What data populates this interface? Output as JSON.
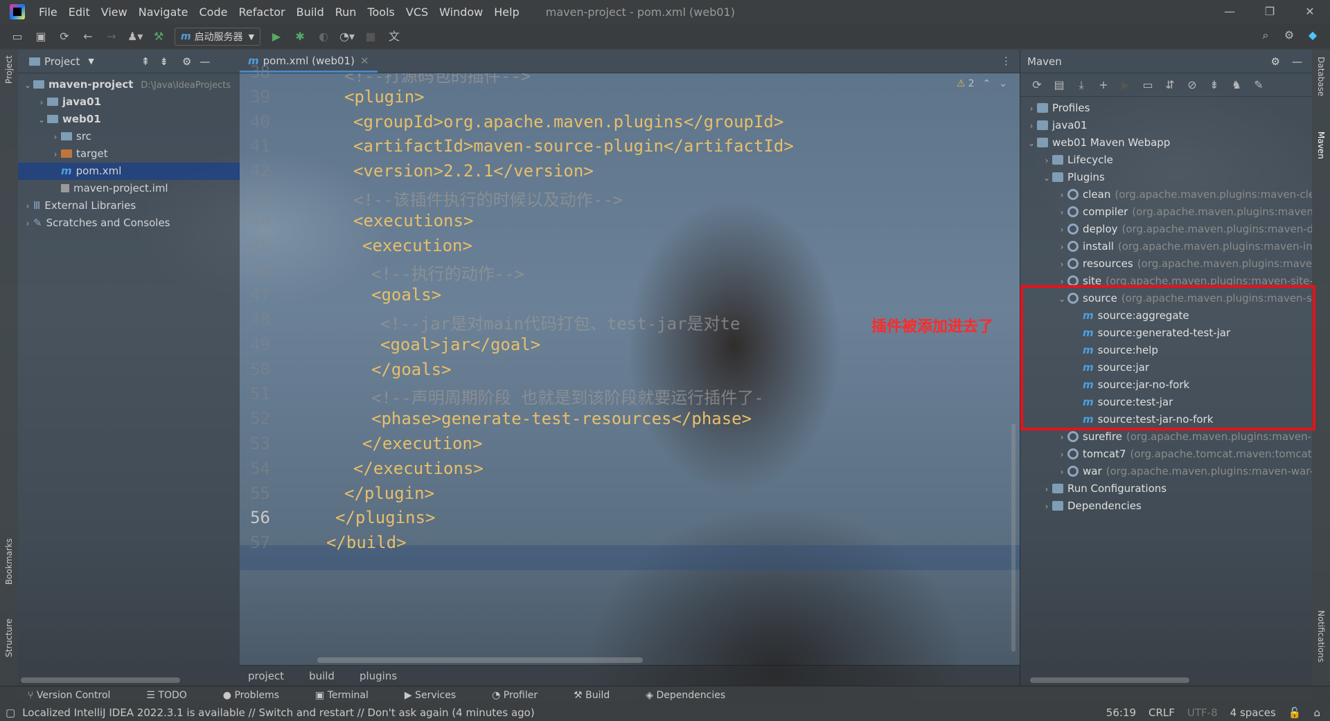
{
  "app": {
    "window_title": "maven-project - pom.xml (web01)",
    "menu": [
      "File",
      "Edit",
      "View",
      "Navigate",
      "Code",
      "Refactor",
      "Build",
      "Run",
      "Tools",
      "VCS",
      "Window",
      "Help"
    ]
  },
  "toolbar": {
    "run_config_label": "启动服务器"
  },
  "project_panel": {
    "title": "Project",
    "tree": [
      {
        "label": "maven-project",
        "path": "D:\\Java\\IdeaProjects",
        "expanded": true
      },
      {
        "label": "java01"
      },
      {
        "label": "web01",
        "expanded": true
      },
      {
        "label": "src"
      },
      {
        "label": "target"
      },
      {
        "label": "pom.xml"
      },
      {
        "label": "maven-project.iml"
      },
      {
        "label": "External Libraries"
      },
      {
        "label": "Scratches and Consoles"
      }
    ]
  },
  "editor": {
    "tab_label": "pom.xml (web01)",
    "inspection_count": "2",
    "line_numbers": [
      "38",
      "39",
      "40",
      "41",
      "42",
      "43",
      "44",
      "45",
      "46",
      "47",
      "48",
      "49",
      "50",
      "51",
      "52",
      "53",
      "54",
      "55",
      "56",
      "57"
    ],
    "current_line": "56",
    "lines": [
      {
        "text": "<!--打源码包的插件-->"
      },
      {
        "text": "<plugin>"
      },
      {
        "text": "<groupId>org.apache.maven.plugins</groupId>"
      },
      {
        "text": "<artifactId>maven-source-plugin</artifactId>"
      },
      {
        "text": "<version>2.2.1</version>"
      },
      {
        "text": "<!--该插件执行的时候以及动作-->"
      },
      {
        "text": "<executions>"
      },
      {
        "text": "<execution>"
      },
      {
        "text": "<!--执行的动作-->"
      },
      {
        "text": "<goals>"
      },
      {
        "text": "<!--jar是对main代码打包、test-jar是对te"
      },
      {
        "text": "<goal>jar</goal>"
      },
      {
        "text": "</goals>"
      },
      {
        "text": "<!--声明周期阶段 也就是到该阶段就要运行插件了-"
      },
      {
        "text": "<phase>generate-test-resources</phase>"
      },
      {
        "text": "</execution>"
      },
      {
        "text": "</executions>"
      },
      {
        "text": "</plugin>"
      },
      {
        "text": "</plugins>"
      },
      {
        "text": "</build>"
      }
    ],
    "breadcrumbs": [
      "project",
      "build",
      "plugins"
    ]
  },
  "maven_panel": {
    "title": "Maven",
    "tree": [
      {
        "label": "Profiles"
      },
      {
        "label": "java01"
      },
      {
        "label": "web01 Maven Webapp"
      },
      {
        "label": "Lifecycle"
      },
      {
        "label": "Plugins"
      },
      {
        "label": "clean",
        "detail": "(org.apache.maven.plugins:maven-clean"
      },
      {
        "label": "compiler",
        "detail": "(org.apache.maven.plugins:maven-"
      },
      {
        "label": "deploy",
        "detail": "(org.apache.maven.plugins:maven-d"
      },
      {
        "label": "install",
        "detail": "(org.apache.maven.plugins:maven-ins"
      },
      {
        "label": "resources",
        "detail": "(org.apache.maven.plugins:maven"
      },
      {
        "label": "site",
        "detail": "(org.apache.maven.plugins:maven-site-"
      },
      {
        "label": "source",
        "detail": "(org.apache.maven.plugins:maven-s"
      },
      {
        "label": "source:aggregate"
      },
      {
        "label": "source:generated-test-jar"
      },
      {
        "label": "source:help"
      },
      {
        "label": "source:jar"
      },
      {
        "label": "source:jar-no-fork"
      },
      {
        "label": "source:test-jar"
      },
      {
        "label": "source:test-jar-no-fork"
      },
      {
        "label": "surefire",
        "detail": "(org.apache.maven.plugins:maven-s"
      },
      {
        "label": "tomcat7",
        "detail": "(org.apache.tomcat.maven:tomcat7"
      },
      {
        "label": "war",
        "detail": "(org.apache.maven.plugins:maven-war-"
      },
      {
        "label": "Run Configurations"
      },
      {
        "label": "Dependencies"
      }
    ]
  },
  "annotation": {
    "text": "插件被添加进去了",
    "color": "#e8121b"
  },
  "side_stripes": {
    "left": [
      "Project",
      "Bookmarks",
      "Structure"
    ],
    "right": [
      "Database",
      "Maven",
      "Notifications"
    ]
  },
  "bottom_tools": [
    "Version Control",
    "TODO",
    "Problems",
    "Terminal",
    "Services",
    "Profiler",
    "Build",
    "Dependencies"
  ],
  "status": {
    "message": "Localized IntelliJ IDEA 2022.3.1 is available // Switch and restart // Don't ask again (4 minutes ago)",
    "position": "56:19",
    "line_sep": "CRLF",
    "encoding": "UTF-8",
    "indent": "4 spaces"
  }
}
